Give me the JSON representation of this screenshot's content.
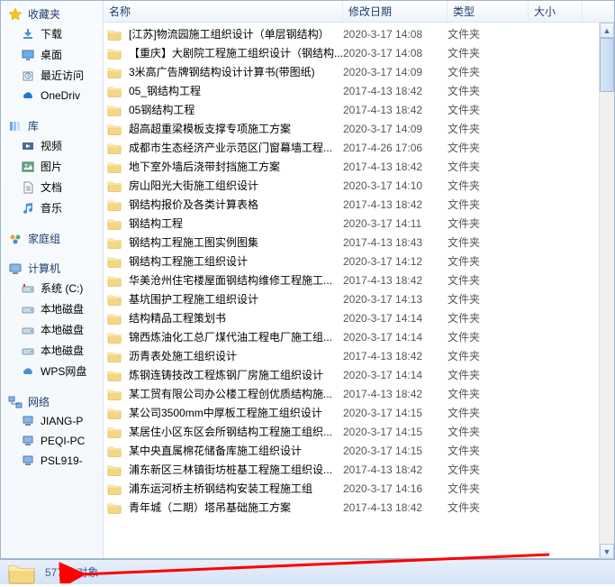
{
  "sidebar": {
    "favorites": {
      "header": "收藏夹",
      "items": [
        {
          "icon": "download",
          "label": "下载"
        },
        {
          "icon": "desktop",
          "label": "桌面"
        },
        {
          "icon": "recent",
          "label": "最近访问"
        },
        {
          "icon": "onedrive",
          "label": "OneDriv"
        }
      ]
    },
    "libraries": {
      "header": "库",
      "items": [
        {
          "icon": "video",
          "label": "视频"
        },
        {
          "icon": "pictures",
          "label": "图片"
        },
        {
          "icon": "documents",
          "label": "文档"
        },
        {
          "icon": "music",
          "label": "音乐"
        }
      ]
    },
    "homegroup": {
      "header": "家庭组"
    },
    "computer": {
      "header": "计算机",
      "items": [
        {
          "icon": "drive",
          "label": "系统 (C:)"
        },
        {
          "icon": "hdd",
          "label": "本地磁盘"
        },
        {
          "icon": "hdd",
          "label": "本地磁盘"
        },
        {
          "icon": "hdd",
          "label": "本地磁盘"
        },
        {
          "icon": "cloud",
          "label": "WPS网盘"
        }
      ]
    },
    "network": {
      "header": "网络",
      "items": [
        {
          "icon": "pc",
          "label": "JIANG-P"
        },
        {
          "icon": "pc",
          "label": "PEQI-PC"
        },
        {
          "icon": "pc",
          "label": "PSL919-"
        }
      ]
    }
  },
  "columns": {
    "name": "名称",
    "date": "修改日期",
    "type": "类型",
    "size": "大小"
  },
  "files": [
    {
      "name": "[江苏]物流园施工组织设计（单层钢结构）",
      "date": "2020-3-17 14:08",
      "type": "文件夹"
    },
    {
      "name": "【重庆】大剧院工程施工组织设计（钢结构...",
      "date": "2020-3-17 14:08",
      "type": "文件夹"
    },
    {
      "name": "3米高广告牌钢结构设计计算书(带图纸)",
      "date": "2020-3-17 14:09",
      "type": "文件夹"
    },
    {
      "name": "05_钢结构工程",
      "date": "2017-4-13 18:42",
      "type": "文件夹"
    },
    {
      "name": "05钢结构工程",
      "date": "2017-4-13 18:42",
      "type": "文件夹"
    },
    {
      "name": "超高超重梁模板支撑专项施工方案",
      "date": "2020-3-17 14:09",
      "type": "文件夹"
    },
    {
      "name": "成都市生态经济产业示范区门窗幕墙工程...",
      "date": "2017-4-26 17:06",
      "type": "文件夹"
    },
    {
      "name": "地下室外墙后浇带封挡施工方案",
      "date": "2017-4-13 18:42",
      "type": "文件夹"
    },
    {
      "name": "房山阳光大街施工组织设计",
      "date": "2020-3-17 14:10",
      "type": "文件夹"
    },
    {
      "name": "钢结构报价及各类计算表格",
      "date": "2017-4-13 18:42",
      "type": "文件夹"
    },
    {
      "name": "钢结构工程",
      "date": "2020-3-17 14:11",
      "type": "文件夹"
    },
    {
      "name": "钢结构工程施工图实例图集",
      "date": "2017-4-13 18:43",
      "type": "文件夹"
    },
    {
      "name": "钢结构工程施工组织设计",
      "date": "2020-3-17 14:12",
      "type": "文件夹"
    },
    {
      "name": "华美沧州住宅楼屋面钢结构维修工程施工...",
      "date": "2017-4-13 18:42",
      "type": "文件夹"
    },
    {
      "name": "基坑围护工程施工组织设计",
      "date": "2020-3-17 14:13",
      "type": "文件夹"
    },
    {
      "name": "结构精品工程策划书",
      "date": "2020-3-17 14:14",
      "type": "文件夹"
    },
    {
      "name": "锦西炼油化工总厂煤代油工程电厂施工组...",
      "date": "2020-3-17 14:14",
      "type": "文件夹"
    },
    {
      "name": "沥青表处施工组织设计",
      "date": "2017-4-13 18:42",
      "type": "文件夹"
    },
    {
      "name": "炼钢连铸技改工程炼钢厂房施工组织设计",
      "date": "2020-3-17 14:14",
      "type": "文件夹"
    },
    {
      "name": "某工贸有限公司办公楼工程创优质结构施...",
      "date": "2017-4-13 18:42",
      "type": "文件夹"
    },
    {
      "name": "某公司3500mm中厚板工程施工组织设计",
      "date": "2020-3-17 14:15",
      "type": "文件夹"
    },
    {
      "name": "某居住小区东区会所钢结构工程施工组织...",
      "date": "2020-3-17 14:15",
      "type": "文件夹"
    },
    {
      "name": "某中央直属棉花储备库施工组织设计",
      "date": "2020-3-17 14:15",
      "type": "文件夹"
    },
    {
      "name": "浦东新区三林镇街坊桩基工程施工组织设...",
      "date": "2017-4-13 18:42",
      "type": "文件夹"
    },
    {
      "name": "浦东运河桥主桥钢结构安装工程施工组",
      "date": "2020-3-17 14:16",
      "type": "文件夹"
    },
    {
      "name": "青年城（二期）塔吊基础施工方案",
      "date": "2017-4-13 18:42",
      "type": "文件夹"
    }
  ],
  "status": {
    "count": "577 个对象"
  }
}
